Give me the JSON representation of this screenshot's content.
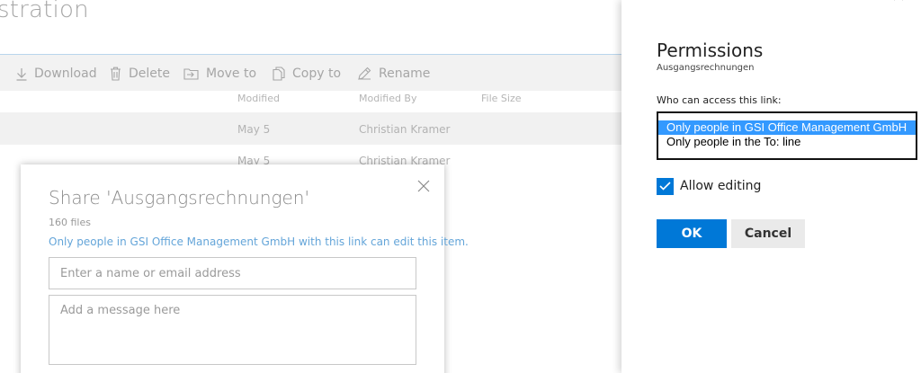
{
  "page": {
    "title": "stration"
  },
  "commands": [
    {
      "label": "Download",
      "icon": "download-icon"
    },
    {
      "label": "Delete",
      "icon": "trash-icon"
    },
    {
      "label": "Move to",
      "icon": "move-icon"
    },
    {
      "label": "Copy to",
      "icon": "copy-icon"
    },
    {
      "label": "Rename",
      "icon": "pencil-icon"
    }
  ],
  "columns": [
    "Modified",
    "Modified By",
    "File Size"
  ],
  "rows": [
    {
      "modified": "May 5",
      "modified_by": "Christian Kramer",
      "file_size": ""
    },
    {
      "modified": "May 5",
      "modified_by": "Christian Kramer",
      "file_size": ""
    }
  ],
  "share": {
    "title": "Share 'Ausgangsrechnungen'",
    "count": "160 files",
    "link_text": "Only people in GSI Office Management GmbH with this link can edit this item.",
    "name_placeholder": "Enter a name or email address",
    "message_placeholder": "Add a message here"
  },
  "permissions": {
    "title": "Permissions",
    "subtitle": "Ausgangsrechnungen",
    "access_label": "Who can access this link:",
    "options": [
      {
        "label": "Only people in GSI Office Management GmbH",
        "selected": true
      },
      {
        "label": "Only people in the To: line",
        "selected": false
      }
    ],
    "allow_editing_label": "Allow editing",
    "allow_editing_checked": true,
    "ok_label": "OK",
    "cancel_label": "Cancel"
  },
  "colors": {
    "accent": "#0078d7",
    "link": "#64a5d9",
    "selected_option": "#3399ff"
  }
}
